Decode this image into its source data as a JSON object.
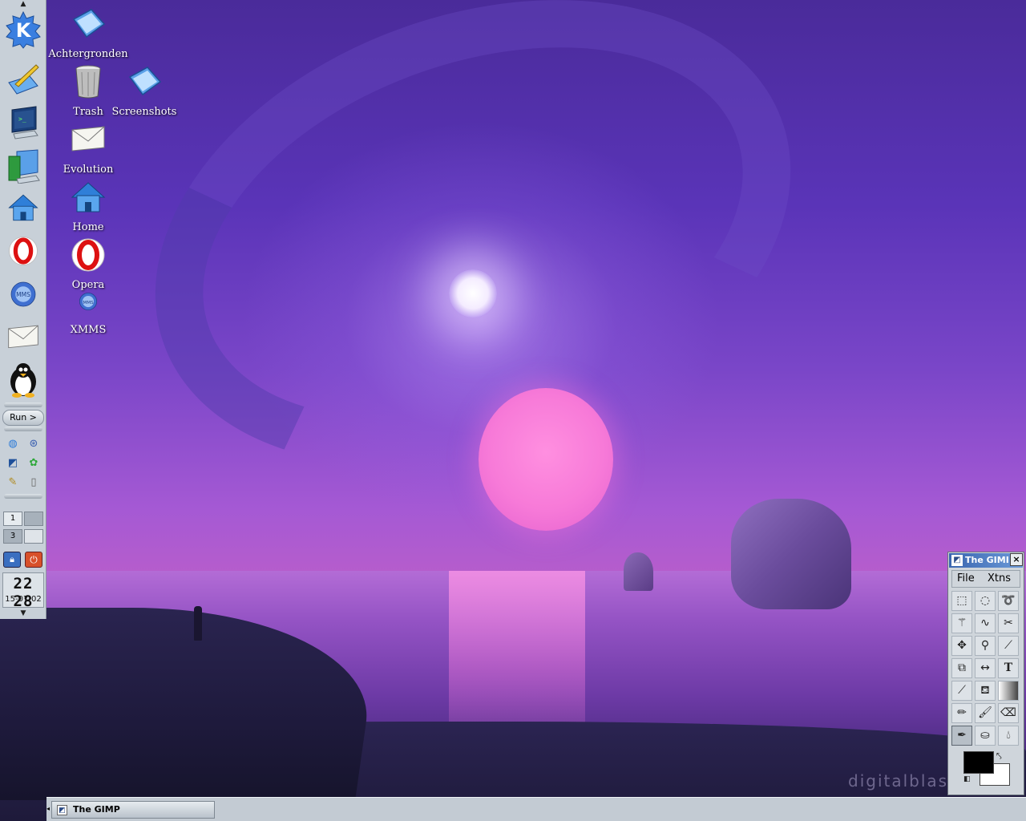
{
  "desktop": {
    "watermark": "digitalblasph",
    "icons": [
      {
        "label": "Achtergronden",
        "icon": "folder-blue-icon"
      },
      {
        "label": "Trash",
        "icon": "trash-icon"
      },
      {
        "label": "Screenshots",
        "icon": "folder-blue-icon"
      },
      {
        "label": "Evolution",
        "icon": "envelope-icon"
      },
      {
        "label": "Home",
        "icon": "home-icon"
      },
      {
        "label": "Opera",
        "icon": "opera-icon"
      },
      {
        "label": "XMMS",
        "icon": "xmms-icon"
      }
    ]
  },
  "kicker": {
    "launchers": [
      "kde-menu-icon",
      "editor-icon",
      "terminal-icon",
      "file-manager-icon",
      "home-icon",
      "opera-icon",
      "xmms-icon",
      "mail-icon",
      "tux-icon"
    ],
    "run_label": "Run >",
    "small_launchers": [
      "globe-icon",
      "konqueror-icon",
      "gimp-icon",
      "gear-green-icon",
      "pencil-icon",
      "document-icon"
    ],
    "pager": {
      "desk1": "1",
      "desk3": "3"
    },
    "clock": {
      "time": "22 28",
      "date": "15-07-02"
    }
  },
  "gimp": {
    "title": "The GIMI",
    "close_label": "×",
    "menu": [
      "File",
      "Xtns"
    ],
    "tools": [
      "rect-select-icon",
      "ellipse-select-icon",
      "lasso-icon",
      "magic-wand-icon",
      "bezier-select-icon",
      "intelligent-scissors-icon",
      "move-icon",
      "magnify-icon",
      "crop-icon",
      "transform-icon",
      "flip-icon",
      "text-icon",
      "color-picker-icon",
      "bucket-fill-icon",
      "gradient-icon",
      "pencil-icon",
      "paintbrush-icon",
      "eraser-icon",
      "airbrush-icon",
      "clone-icon",
      "convolve-icon"
    ],
    "active_tool": "airbrush-icon",
    "foreground_color": "#000000",
    "background_color": "#ffffff"
  },
  "taskbar": {
    "items": [
      {
        "label": "The GIMP",
        "icon": "gimp-icon"
      }
    ]
  }
}
